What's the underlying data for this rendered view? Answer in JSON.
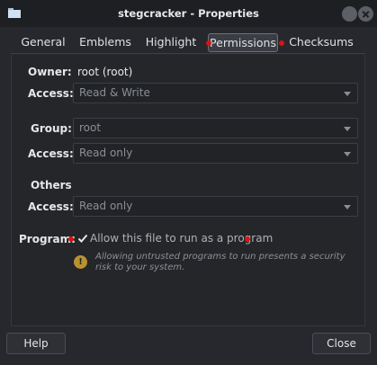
{
  "window": {
    "title": "stegcracker - Properties"
  },
  "tabs": [
    {
      "label": "General"
    },
    {
      "label": "Emblems"
    },
    {
      "label": "Highlight"
    },
    {
      "label": "Permissions"
    },
    {
      "label": "Checksums"
    }
  ],
  "permissions": {
    "owner_label": "Owner:",
    "owner_value": "root (root)",
    "owner_access_label": "Access:",
    "owner_access_value": "Read & Write",
    "group_label": "Group:",
    "group_value": "root",
    "group_access_label": "Access:",
    "group_access_value": "Read only",
    "others_label": "Others",
    "others_access_label": "Access:",
    "others_access_value": "Read only",
    "program_label": "Program:",
    "program_checkbox_label": "Allow this file to run as a program",
    "program_checked": true,
    "warning_text": "Allowing untrusted programs to run presents a security risk to your system."
  },
  "footer": {
    "help_label": "Help",
    "close_label": "Close"
  },
  "colors": {
    "marker": "#e01010",
    "warning": "#b7922f",
    "background": "#26282d"
  }
}
